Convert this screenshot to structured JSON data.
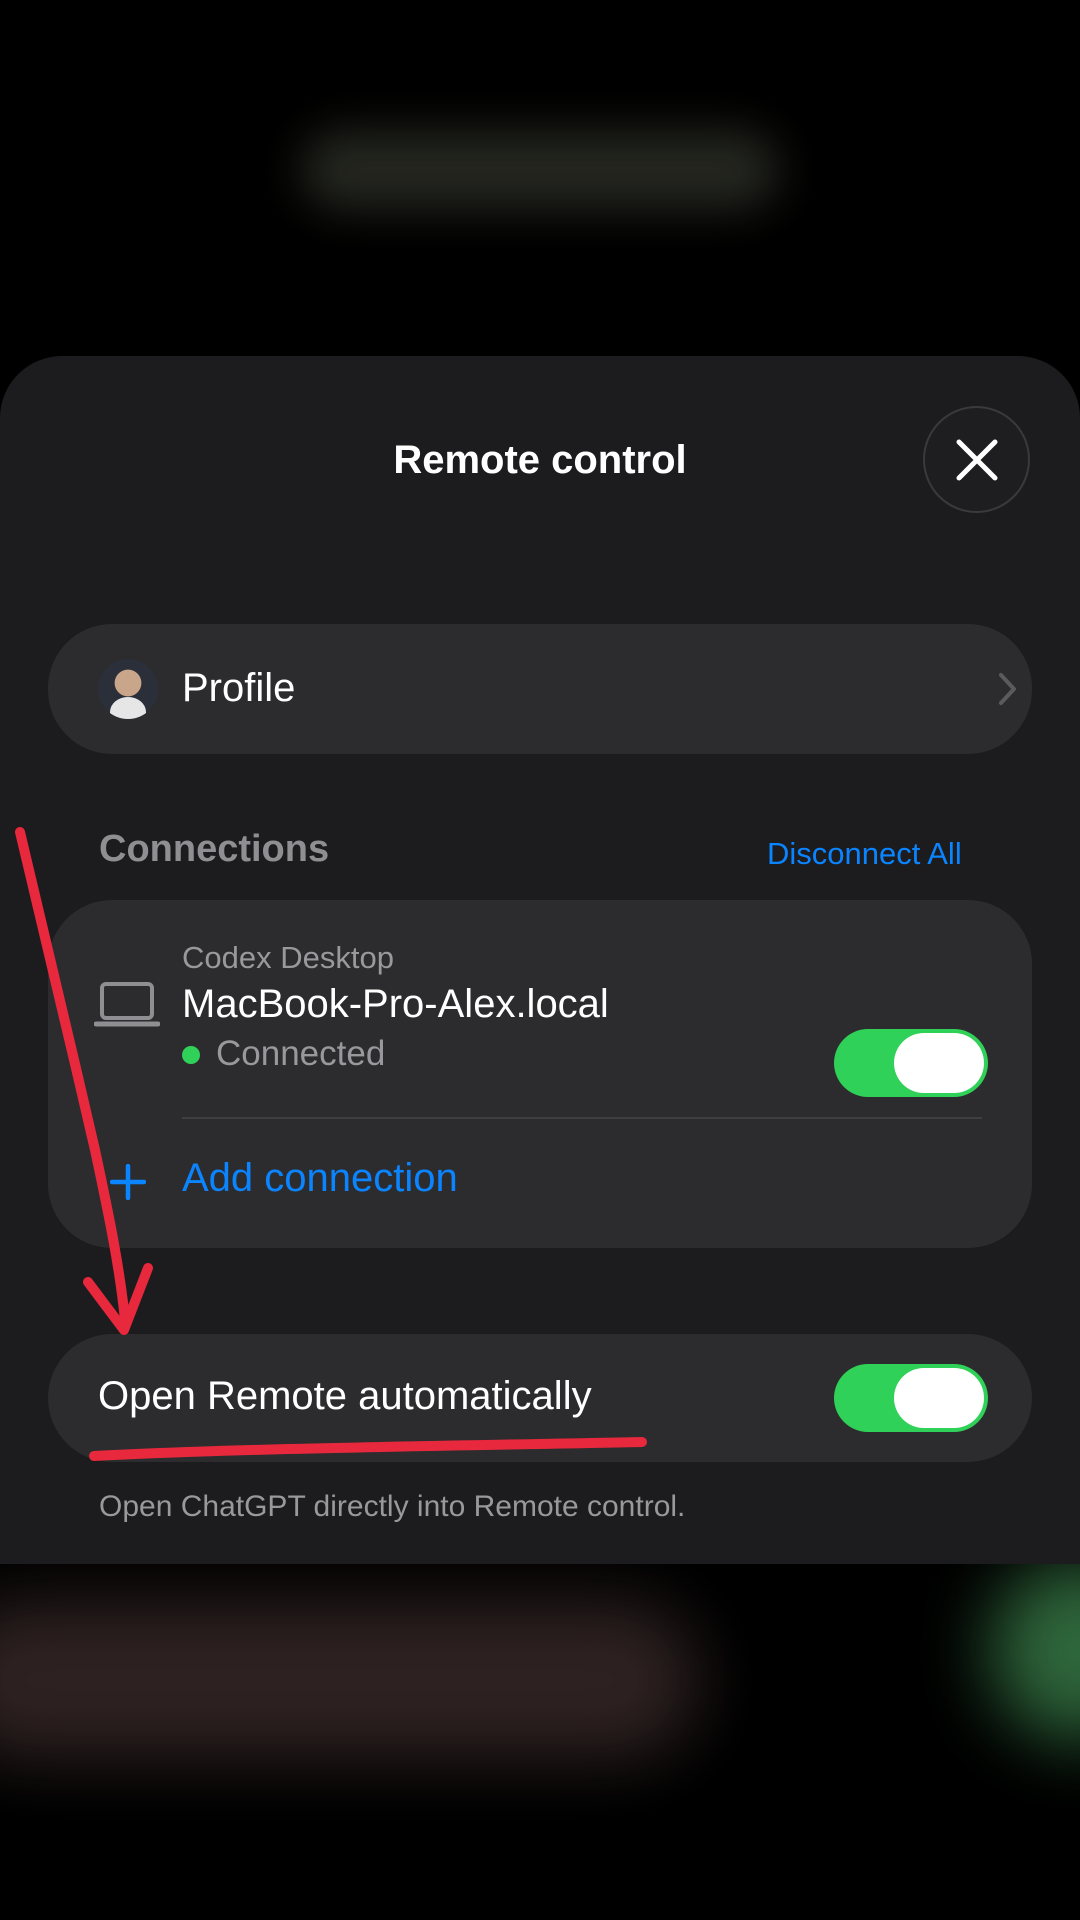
{
  "sheet": {
    "title": "Remote control"
  },
  "profile": {
    "label": "Profile"
  },
  "connections": {
    "header": "Connections",
    "disconnect_all": "Disconnect All",
    "device": {
      "kind": "Codex Desktop",
      "name": "MacBook-Pro-Alex.local",
      "status": "Connected",
      "status_color": "#30d158",
      "enabled": true
    },
    "add_connection": "Add connection"
  },
  "auto_open": {
    "label": "Open Remote automatically",
    "enabled": true,
    "note": "Open ChatGPT directly into Remote control."
  },
  "colors": {
    "accent": "#0a84ff",
    "toggle_on": "#30d158",
    "annotation": "#e8283c"
  },
  "icons": [
    "close-icon",
    "chevron-right-icon",
    "laptop-icon",
    "plus-icon"
  ]
}
